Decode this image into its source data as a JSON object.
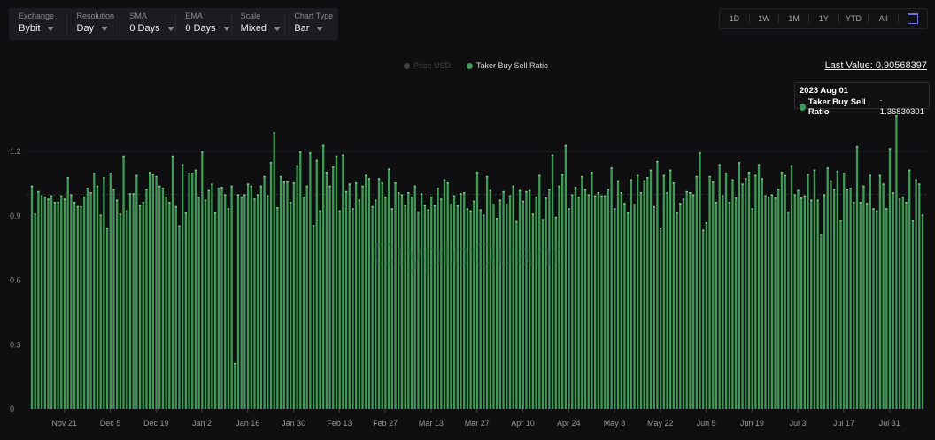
{
  "toolbar": {
    "controls": [
      {
        "label": "Exchange",
        "value": "Bybit"
      },
      {
        "label": "Resolution",
        "value": "Day"
      },
      {
        "label": "SMA",
        "value": "0 Days"
      },
      {
        "label": "EMA",
        "value": "0 Days"
      },
      {
        "label": "Scale",
        "value": "Mixed"
      },
      {
        "label": "Chart Type",
        "value": "Bar"
      }
    ]
  },
  "range_buttons": [
    "1D",
    "1W",
    "1M",
    "1Y",
    "YTD",
    "All"
  ],
  "legend": {
    "disabled": "Price USD",
    "active": "Taker Buy Sell Ratio"
  },
  "last_value": "Last Value: 0.90568397",
  "tooltip": {
    "date": "2023 Aug 01",
    "series": "Taker Buy Sell Ratio",
    "value": ": 1.36830301"
  },
  "watermark": "CryptoQuant",
  "colors": {
    "bar": "#3f9a56",
    "bar_top": "#7fcf8f",
    "accent": "#6b74d6",
    "dot": "#3f9a56"
  },
  "chart_data": {
    "type": "bar",
    "title": "Taker Buy Sell Ratio",
    "start_date": "2022-11-10",
    "interval": "1 day",
    "ylim": [
      0,
      1.2
    ],
    "yticks": [
      "0",
      "0.3",
      "0.6",
      "0.9",
      "1.2"
    ],
    "xticks": [
      "Nov 21",
      "Dec 5",
      "Dec 19",
      "Jan 2",
      "Jan 16",
      "Jan 30",
      "Feb 13",
      "Feb 27",
      "Mar 13",
      "Mar 27",
      "Apr 10",
      "Apr 24",
      "May 8",
      "May 22",
      "Jun 5",
      "Jun 19",
      "Jul 3",
      "Jul 17",
      "Jul 31"
    ],
    "values": [
      1.04,
      0.91,
      1.015,
      0.995,
      0.99,
      0.98,
      0.995,
      0.965,
      0.965,
      0.995,
      0.98,
      1.08,
      1.0,
      0.965,
      0.945,
      0.945,
      0.99,
      1.03,
      1.01,
      1.1,
      1.04,
      0.905,
      1.08,
      0.845,
      1.1,
      1.025,
      0.975,
      0.91,
      1.18,
      0.925,
      1.005,
      1.005,
      1.09,
      0.95,
      0.965,
      1.025,
      1.105,
      1.095,
      1.085,
      1.04,
      1.03,
      0.99,
      0.965,
      1.18,
      0.945,
      0.855,
      1.14,
      0.915,
      1.1,
      1.1,
      1.115,
      0.99,
      1.2,
      0.975,
      1.02,
      1.05,
      0.915,
      1.03,
      1.035,
      1.0,
      0.935,
      1.04,
      0.215,
      1.0,
      0.99,
      1.0,
      1.05,
      1.04,
      0.98,
      1.0,
      1.04,
      1.085,
      0.995,
      1.15,
      1.29,
      0.94,
      1.085,
      1.06,
      1.06,
      0.965,
      1.055,
      1.135,
      1.2,
      0.99,
      1.04,
      1.195,
      0.857,
      1.16,
      0.925,
      1.23,
      1.105,
      1.04,
      1.13,
      1.18,
      0.925,
      1.185,
      1.015,
      1.05,
      0.935,
      1.055,
      0.975,
      1.04,
      1.09,
      1.075,
      0.945,
      0.975,
      1.075,
      1.055,
      0.99,
      1.12,
      0.935,
      1.055,
      1.01,
      1.0,
      0.95,
      1.01,
      0.99,
      1.04,
      0.92,
      1.005,
      0.95,
      0.93,
      0.99,
      0.95,
      1.03,
      0.98,
      1.07,
      1.055,
      0.955,
      0.995,
      0.95,
      1.005,
      1.01,
      0.935,
      0.925,
      0.97,
      1.105,
      0.93,
      0.905,
      1.085,
      1.02,
      0.955,
      0.89,
      0.975,
      1.015,
      0.955,
      0.995,
      1.04,
      0.875,
      1.02,
      0.97,
      1.015,
      1.02,
      0.91,
      0.99,
      1.09,
      0.885,
      0.985,
      1.025,
      1.185,
      0.895,
      1.04,
      1.095,
      1.23,
      0.935,
      1.0,
      1.035,
      0.99,
      1.085,
      1.025,
      1.0,
      1.105,
      0.995,
      1.01,
      0.995,
      0.995,
      1.025,
      1.125,
      0.935,
      1.065,
      1.01,
      0.96,
      0.915,
      1.07,
      0.955,
      1.09,
      1.01,
      1.065,
      1.08,
      1.115,
      0.945,
      1.155,
      0.845,
      1.09,
      1.01,
      1.115,
      1.055,
      0.915,
      0.96,
      0.98,
      1.015,
      1.01,
      1.0,
      1.085,
      1.195,
      0.835,
      0.87,
      1.085,
      1.06,
      0.965,
      1.14,
      0.995,
      1.1,
      0.965,
      1.07,
      0.985,
      1.15,
      1.05,
      1.075,
      1.105,
      0.935,
      1.09,
      1.14,
      1.075,
      0.995,
      0.99,
      1.0,
      0.985,
      1.025,
      1.105,
      1.09,
      0.92,
      1.135,
      1.0,
      1.02,
      0.985,
      0.995,
      1.095,
      0.975,
      1.115,
      0.975,
      0.815,
      1.0,
      1.125,
      1.065,
      1.025,
      1.11,
      0.88,
      1.1,
      1.025,
      1.03,
      0.965,
      1.225,
      0.965,
      1.04,
      0.96,
      1.09,
      0.935,
      0.925,
      1.09,
      1.05,
      0.935,
      1.215,
      1.01,
      1.3683,
      0.98,
      0.99,
      0.965,
      1.115,
      0.88,
      1.07,
      1.05,
      0.9057
    ]
  }
}
